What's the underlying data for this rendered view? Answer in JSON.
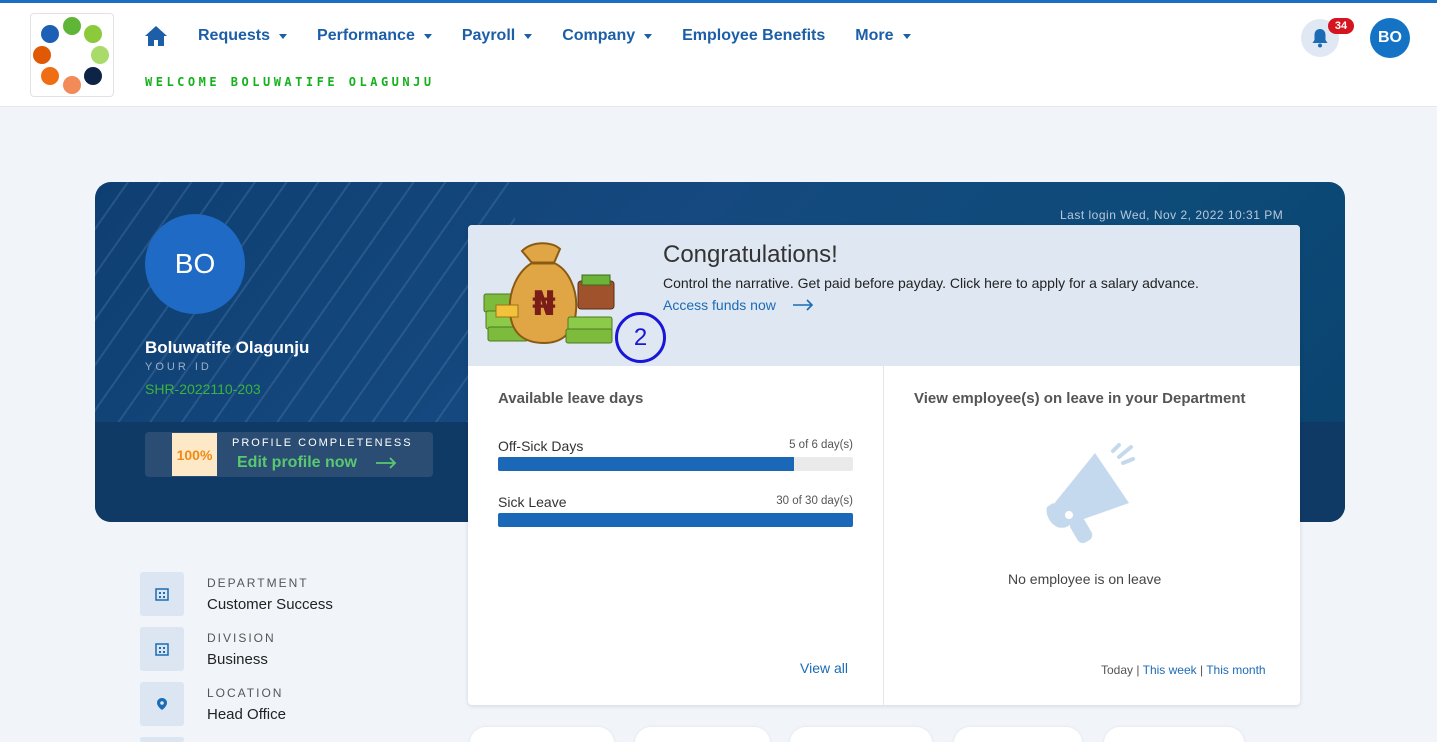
{
  "header": {
    "nav": [
      {
        "label": "Requests",
        "dropdown": true
      },
      {
        "label": "Performance",
        "dropdown": true
      },
      {
        "label": "Payroll",
        "dropdown": true
      },
      {
        "label": "Company",
        "dropdown": true
      },
      {
        "label": "Employee Benefits",
        "dropdown": false
      },
      {
        "label": "More",
        "dropdown": true
      }
    ],
    "welcome": "WELCOME BOLUWATIFE OLAGUNJU",
    "notification_count": "34",
    "avatar_initials": "BO",
    "icons": {
      "home": "home-icon",
      "bell": "bell-icon"
    }
  },
  "profile": {
    "initials": "BO",
    "name": "Boluwatife Olagunju",
    "id_label": "YOUR ID",
    "id_value": "SHR-2022110-203",
    "completeness_percent": "100%",
    "completeness_label": "PROFILE COMPLETENESS",
    "edit_link": "Edit profile now",
    "last_login": "Last login Wed, Nov 2, 2022 10:31 PM"
  },
  "promo": {
    "title": "Congratulations!",
    "text": "Control the narrative. Get paid before payday. Click here to apply for a salary advance.",
    "link": "Access funds now",
    "step_marker": "2",
    "currency_symbol": "₦"
  },
  "leave": {
    "title": "Available leave days",
    "items": [
      {
        "name": "Off-Sick Days",
        "count": "5 of 6 day(s)",
        "fraction": 0.833
      },
      {
        "name": "Sick Leave",
        "count": "30 of 30 day(s)",
        "fraction": 1.0
      }
    ],
    "view_all": "View all"
  },
  "department_leave": {
    "title": "View employee(s) on leave in your Department",
    "empty_text": "No employee is on leave",
    "periods": {
      "today": "Today",
      "week": "This week",
      "month": "This month"
    },
    "icon": "megaphone-icon"
  },
  "info": [
    {
      "label": "DEPARTMENT",
      "value": "Customer Success",
      "icon": "building-icon"
    },
    {
      "label": "DIVISION",
      "value": "Business",
      "icon": "building-icon"
    },
    {
      "label": "LOCATION",
      "value": "Head Office",
      "icon": "location-pin-icon"
    }
  ],
  "colors": {
    "primary": "#1c5ea8",
    "accent_green": "#16b11d",
    "banner": "#103a66",
    "badge": "#d6141f"
  }
}
